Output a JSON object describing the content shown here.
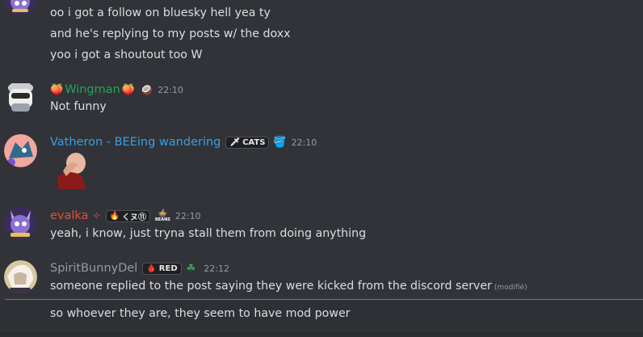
{
  "messages": {
    "m1": {
      "lines": [
        "oo i got a follow on bluesky hell yea ty",
        "and he's replying to my posts w/ the doxx",
        "yoo i got a shoutout too W"
      ]
    },
    "m2": {
      "username": "Wingman",
      "username_color": "#23a55a",
      "prefix_emoji": "🍑",
      "suffix_emoji": "🍑",
      "badge_emoji": "🥥",
      "timestamp": "22:10",
      "text": "Not funny"
    },
    "m3": {
      "username": "Vatheron - BEEing wandering",
      "username_color": "#3b9ee0",
      "tag_icon": "🗡",
      "tag_label": "CATS",
      "badge_emoji": "🪣",
      "timestamp": "22:10"
    },
    "m4": {
      "username": "evalka",
      "username_color": "#e0503c",
      "sparkle": "✧",
      "tag_icon": "🔥",
      "tag_label": "くヌ⑪",
      "badge_label": "BEANS",
      "timestamp": "22:10",
      "text": "yeah, i know, just tryna stall them from doing anything"
    },
    "m5": {
      "username": "SpiritBunnyDel",
      "username_color": "#949ba4",
      "tag_icon": "🩸",
      "tag_label": "RED",
      "badge_emoji": "☘",
      "timestamp": "22:12",
      "text": "someone replied to the post saying they were kicked from the discord server",
      "edited_label": "(modifié)",
      "text2": "so whoever they are, they seem to have mod power"
    }
  },
  "colors": {
    "background": "#313338",
    "new_message_divider": "#f23f43",
    "text": "#dbdee1",
    "muted": "#949ba4"
  },
  "icons": {
    "avatar_m1": "purple-character-avatar-icon",
    "avatar_m2": "robot-helmet-avatar-icon",
    "avatar_m3": "blue-creature-avatar-icon",
    "avatar_m4": "purple-character-avatar-icon",
    "avatar_m5": "white-haired-character-avatar-icon",
    "attachment": "facepalm-image"
  }
}
